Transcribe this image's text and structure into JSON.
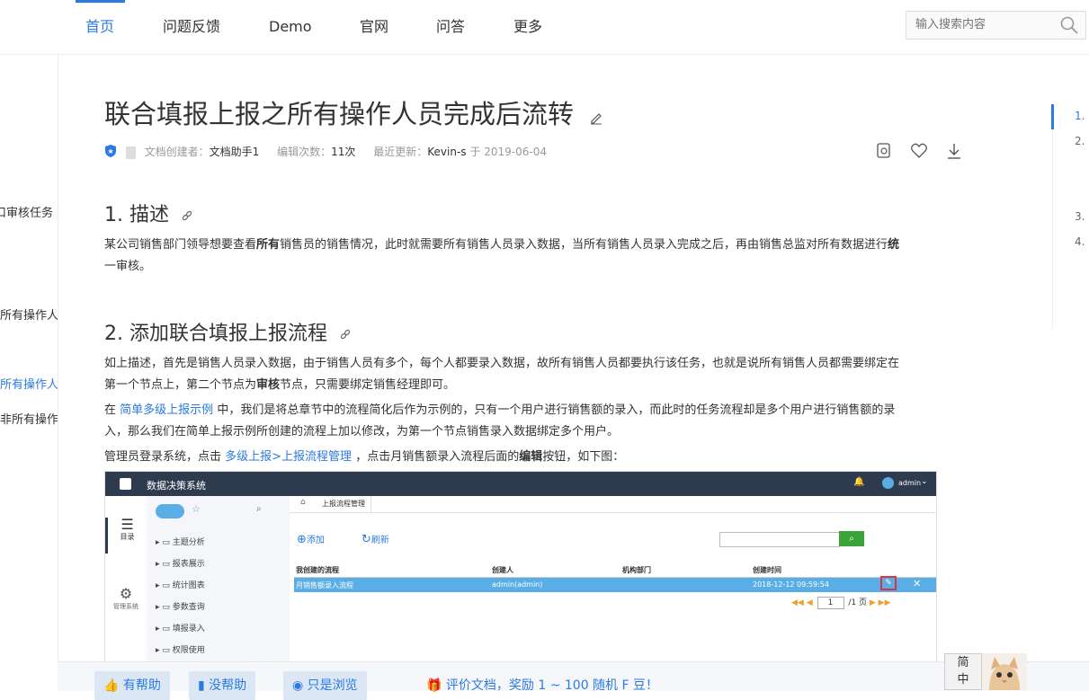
{
  "nav": {
    "items": [
      "首页",
      "问题反馈",
      "Demo",
      "官网",
      "问答",
      "更多"
    ],
    "active": "首页"
  },
  "search": {
    "placeholder": "输入搜索内容"
  },
  "left_sidebar": {
    "items": [
      "口审核任务",
      "所有操作人",
      "所有操作人",
      "非所有操作"
    ]
  },
  "article": {
    "title": "联合填报上报之所有操作人员完成后流转",
    "meta": {
      "creator_label": "文档创建者：",
      "creator": "文档助手1",
      "edits_label": "编辑次数：",
      "edits": "11次",
      "updated_label": "最近更新：",
      "updated_by": "Kevin-s",
      "updated_on_label": "于",
      "updated_date": "2019-06-04"
    },
    "section1": {
      "heading": "1. 描述",
      "p1_a": "某公司销售部门领导想要查看",
      "p1_b": "所有",
      "p1_c": "销售员的销售情况，此时就需要所有销售人员录入数据，当所有销售人员录入完成之后，再由销售总监对所有数据进行",
      "p1_d": "统",
      "p1_e": "一审核。"
    },
    "section2": {
      "heading": "2. 添加联合填报上报流程",
      "p1_a": "如上描述，首先是销售人员录入数据，由于销售人员有多个，每个人都要录入数据，故所有销售人员都要执行该任务，也就是说所有销售人员都需要绑定在",
      "p1_b": "第一个节点上，第二个节点为",
      "p1_c": "审核",
      "p1_d": "节点，只需要绑定销售经理即可。",
      "p2_a": "在",
      "p2_link": "简单多级上报示例",
      "p2_b": "中，我们是将总章节中的流程简化后作为示例的，只有一个用户进行销售额的录入，而此时的任务流程却是多个用户进行销售额的录",
      "p2_c": "入，那么我们在简单上报示例所创建的流程上加以修改，为第一个节点销售录入数据绑定多个用户。",
      "p3_a": "管理员登录系统，点击",
      "p3_link": "多级上报>上报流程管理",
      "p3_b": "，点击月销售额录入流程后面的",
      "p3_c": "编辑",
      "p3_d": "按钮，如下图："
    }
  },
  "toc": {
    "items": [
      "1.",
      "2.",
      "3.",
      "4."
    ]
  },
  "screenshot": {
    "app_title": "数据决策系统",
    "user": "admin",
    "side_items": [
      "目录",
      "管理系统"
    ],
    "tree_items": [
      "主题分析",
      "报表展示",
      "统计图表",
      "参数查询",
      "填报录入",
      "权限使用"
    ],
    "tab": "上报流程管理",
    "add_label": "添加",
    "refresh_label": "刷新",
    "columns": [
      "我创建的流程",
      "创建人",
      "机构部门",
      "创建时间"
    ],
    "row": [
      "月销售额录入流程",
      "admin(admin)",
      "",
      "2018-12-12 09:59:54"
    ],
    "page_current": "1",
    "page_total": "/1 页"
  },
  "bottom": {
    "helpful": "有帮助",
    "not_helpful": "没帮助",
    "just_browsing": "只是浏览",
    "reward": "评价文档，奖励 1 ~ 100 随机 F 豆！"
  },
  "lang": {
    "simplified": "简",
    "chinese": "中"
  },
  "colors": {
    "accent": "#2a7ae2",
    "shot_header": "#2e3a4e",
    "row_selected": "#5aaee6"
  }
}
